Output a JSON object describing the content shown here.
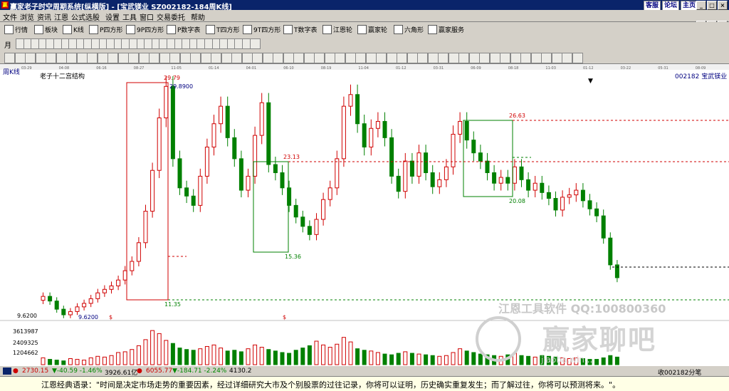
{
  "window": {
    "title": "赢家老子时空周期系统[纵横版] - [宝武镁业  SZ002182-184周K线]",
    "icon_text": "赢",
    "links": [
      "客服",
      "论坛",
      "主页"
    ]
  },
  "menu": [
    "文件",
    "浏览",
    "资讯",
    "江恩",
    "公式选股",
    "设置",
    "工具",
    "窗口",
    "交易委托",
    "帮助"
  ],
  "toolbar": {
    "items": [
      "行情",
      "板块",
      "K线",
      "P四方形",
      "9P四方形",
      "P数字表",
      "T四方形",
      "9T四方形",
      "T数字表",
      "江恩轮",
      "赢家轮",
      "六角形",
      "赢家服务"
    ],
    "period": "月",
    "digit": "0"
  },
  "chart": {
    "period_label": "周K线",
    "indicator_label": "老子十二宫结构",
    "stock_label": "002182 宝武镁业",
    "top_dates": [
      "03-29",
      "04-08",
      "06-16",
      "08-27",
      "11-05",
      "01-14",
      "04-01",
      "06-10",
      "08-19",
      "11-04",
      "01-12",
      "03-31",
      "06-09",
      "08-18",
      "11-03",
      "01-12",
      "03-22",
      "05-31",
      "08-09"
    ],
    "annotations": [
      "29.79",
      "29.8900",
      "23.13",
      "26.63",
      "20.08",
      "15.36",
      "11.35",
      "9.6200"
    ],
    "axis_labels": {
      "price_low": "9.6200",
      "vol1": "3613987",
      "vol2": "2409325",
      "vol3": "1204662"
    },
    "marker": "$"
  },
  "chart_data": {
    "type": "candlestick",
    "title": "老子十二宫结构",
    "ylabel": "",
    "ylim": [
      9.62,
      29.89
    ],
    "closes": [
      11.2,
      10.8,
      10.1,
      9.62,
      9.9,
      10.3,
      10.6,
      11,
      11.5,
      11.8,
      12.1,
      12.6,
      13.4,
      14.2,
      15.8,
      18.5,
      22,
      26.5,
      29.2,
      23,
      20.5,
      19.8,
      19,
      21.5,
      24,
      26,
      27.5,
      24.8,
      23,
      20.3,
      21.5,
      25,
      27.8,
      22.5,
      21.8,
      20.5,
      19,
      18,
      17.2,
      16.5,
      17.8,
      19.5,
      20.5,
      23,
      27.5,
      28.5,
      26,
      24,
      25.6,
      26.2,
      24.8,
      21.5,
      20.2,
      22.8,
      21.5,
      23.5,
      21.8,
      20.6,
      21.2,
      22.3,
      25.1,
      26.2,
      24.6,
      23.5,
      22.8,
      21.8,
      20.9,
      21.4,
      20.9,
      22.3,
      21.2,
      20.3,
      20.9,
      20.1,
      19.6,
      18.6,
      19.7,
      19.9,
      20.3,
      19.4,
      18.7,
      18.1,
      16.2,
      13.9,
      12.8
    ],
    "volumes": [
      0.9,
      0.7,
      0.6,
      0.5,
      0.8,
      0.7,
      0.6,
      0.9,
      1.1,
      1.0,
      1.2,
      1.6,
      1.7,
      2.0,
      2.5,
      3.3,
      4.5,
      4.1,
      3.2,
      2.8,
      2.2,
      2.0,
      1.9,
      2.1,
      2.4,
      2.6,
      2.2,
      1.8,
      1.9,
      1.7,
      2.1,
      2.6,
      2.3,
      2.0,
      1.8,
      1.6,
      1.5,
      1.9,
      2.2,
      2.5,
      3.1,
      2.6,
      2.3,
      2.7,
      3.6,
      3.0,
      2.1,
      1.9,
      1.8,
      1.6,
      1.4,
      1.3,
      1.5,
      1.7,
      1.5,
      1.4,
      1.3,
      1.2,
      1.1,
      1.2,
      1.6,
      2.1,
      1.8,
      1.6,
      1.4,
      1.3,
      1.2,
      1.1,
      1.3,
      1.5,
      1.2,
      1.1,
      1.0,
      1.2,
      1.1,
      1.0,
      0.9,
      0.8,
      0.9,
      0.8,
      0.7,
      0.7,
      0.9,
      1.2,
      1.0
    ]
  },
  "watermark": {
    "line1": "江恩工具软件  QQ:100800360",
    "line2": "赢家聊吧",
    "line3": "jiaoba.win..."
  },
  "status": {
    "sh_index": "2730.15",
    "sh_chg": "▼-40.59 -1.46%",
    "sh_amt": "3926.61亿",
    "sz_index": "6055.77",
    "sz_chg": "▼-184.71 -2.24%",
    "sz_amt": "4130.2",
    "right": "收002182分笔"
  },
  "quote": "江恩经典语录：\"时间是决定市场走势的重要因素，经过详细研究大市及个别股票的过往记录，你将可以证明，历史确实重复发生；而了解过往，你将可以预测将来。\"。",
  "colors": {
    "up": "#d00000",
    "down": "#008000",
    "line_red": "#d00000",
    "line_green": "#008000",
    "date": "#000080"
  }
}
